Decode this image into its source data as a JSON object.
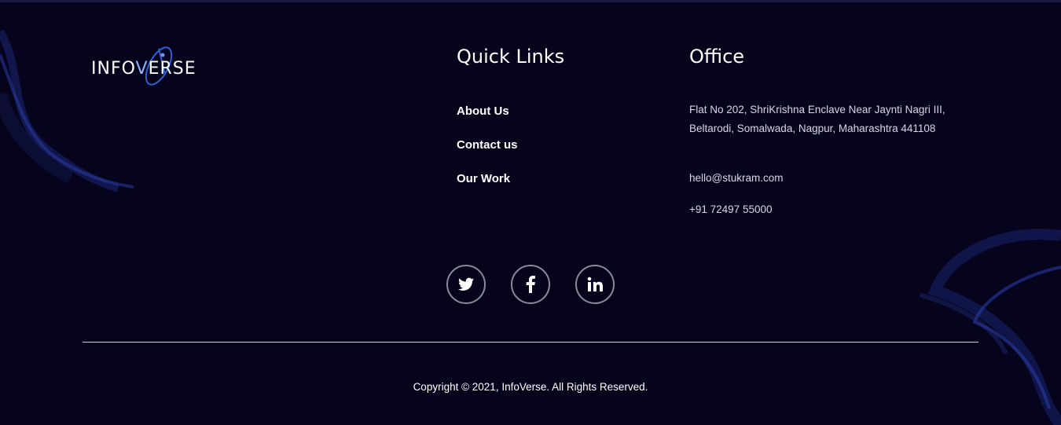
{
  "brand": {
    "logo_text_part1": "INFO",
    "logo_text_v": "V",
    "logo_text_part2": "ERSE",
    "accent_color": "#2f5fd6",
    "background_color": "#06041d"
  },
  "quick_links": {
    "title": "Quick Links",
    "items": [
      {
        "label": "About Us"
      },
      {
        "label": "Contact us"
      },
      {
        "label": "Our Work"
      }
    ]
  },
  "office": {
    "title": "Office",
    "address": "Flat No 202, ShriKrishna Enclave Near Jaynti Nagri III, Beltarodi, Somalwada, Nagpur, Maharashtra 441108",
    "email": "hello@stukram.com",
    "phone": "+91 72497 55000"
  },
  "social": [
    {
      "icon": "twitter-icon"
    },
    {
      "icon": "facebook-icon"
    },
    {
      "icon": "linkedin-icon"
    }
  ],
  "footer": {
    "copyright": "Copyright © 2021, InfoVerse. All Rights Reserved."
  }
}
